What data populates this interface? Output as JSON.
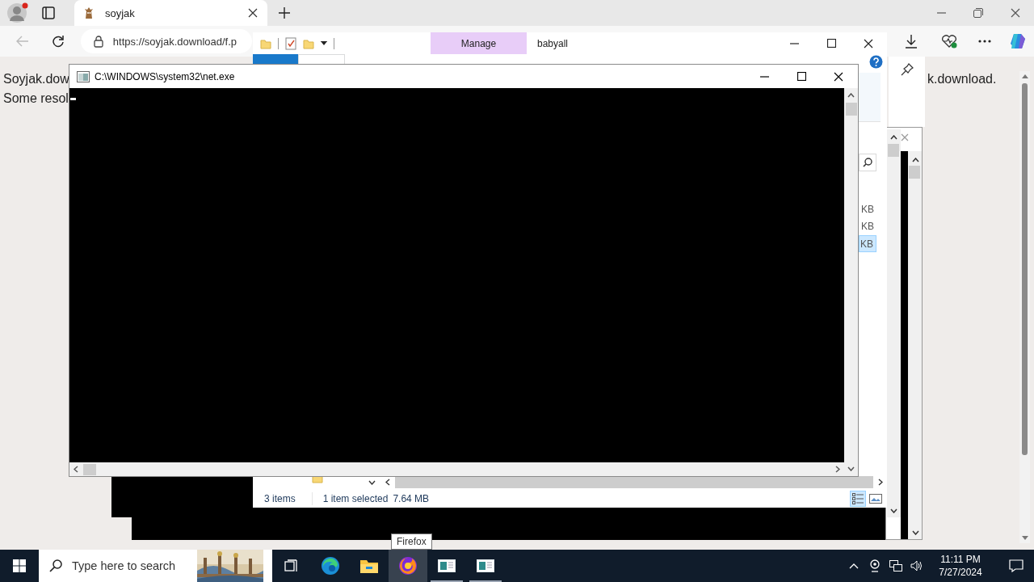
{
  "browser": {
    "tab_title": "soyjak",
    "url": "https://soyjak.download/f.p",
    "page_lines": [
      "Soyjak.dow",
      "Some resol"
    ],
    "page_text_right": "k.download."
  },
  "explorer": {
    "contextual_tab": "Manage",
    "title": "babyall",
    "ribbon_tabs": [
      {
        "kind": "file",
        "selected": false
      },
      {
        "kind": "tab",
        "selected": true
      }
    ],
    "files": [
      {
        "size": "KB",
        "selected": false
      },
      {
        "size": "KB",
        "selected": false
      },
      {
        "size": "KB",
        "selected": true
      }
    ],
    "status": {
      "items": "3 items",
      "selection": "1 item selected",
      "size": "7.64 MB"
    },
    "views": [
      {
        "kind": "details",
        "selected": true
      },
      {
        "kind": "thumbnails",
        "selected": false
      }
    ]
  },
  "console": {
    "title": "C:\\WINDOWS\\system32\\net.exe"
  },
  "tooltip": "Firefox",
  "taskbar": {
    "search": {
      "placeholder": "Type here to search"
    },
    "apps": [
      {
        "kind": "task-view",
        "selected": false,
        "running": false
      },
      {
        "kind": "edge",
        "selected": false,
        "running": false
      },
      {
        "kind": "explorer",
        "selected": false,
        "running": false
      },
      {
        "kind": "firefox",
        "selected": true,
        "running": true
      },
      {
        "kind": "window",
        "selected": false,
        "running": true
      },
      {
        "kind": "window",
        "selected": false,
        "running": true
      }
    ],
    "time": "11:11 PM",
    "date": "7/27/2024"
  }
}
